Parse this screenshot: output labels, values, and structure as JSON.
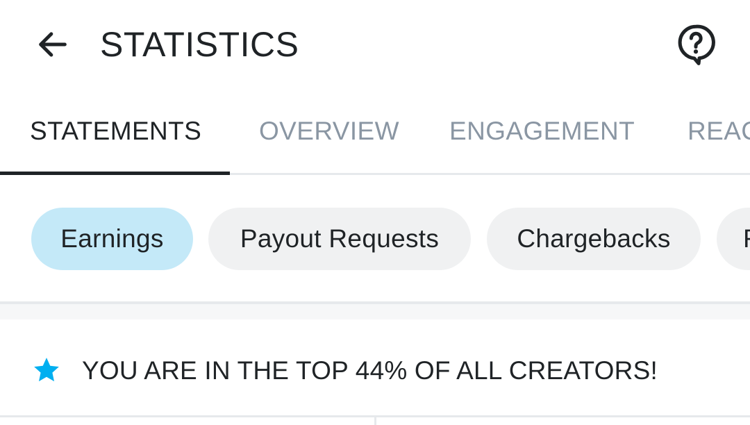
{
  "header": {
    "title": "STATISTICS",
    "back_icon": "arrow-left-icon",
    "help_icon": "question-bubble-icon"
  },
  "tabs": [
    {
      "label": "STATEMENTS",
      "active": true
    },
    {
      "label": "OVERVIEW",
      "active": false
    },
    {
      "label": "ENGAGEMENT",
      "active": false
    },
    {
      "label": "REACH",
      "active": false
    }
  ],
  "chips": [
    {
      "label": "Earnings",
      "active": true
    },
    {
      "label": "Payout Requests",
      "active": false
    },
    {
      "label": "Chargebacks",
      "active": false
    },
    {
      "label": "Referrals",
      "active": false
    }
  ],
  "banner": {
    "icon": "star-icon",
    "text": "YOU ARE IN THE TOP 44% OF ALL CREATORS!"
  },
  "colors": {
    "accent": "#00aff0",
    "active_chip": "#c4e9f8",
    "chip": "#f0f1f2",
    "inactive_tab": "#8a96a3",
    "text": "#1f2326"
  }
}
